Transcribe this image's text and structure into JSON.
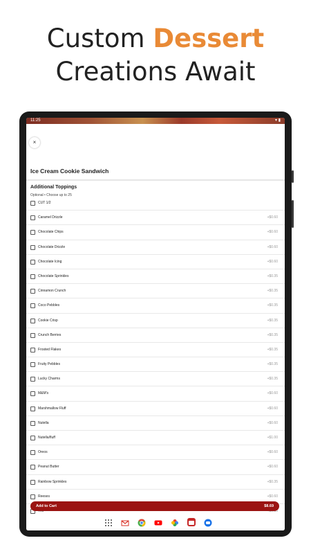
{
  "headline": {
    "line1_prefix": "Custom ",
    "line1_accent": "Dessert",
    "line2": "Creations Await"
  },
  "status": {
    "time": "11:25",
    "right": "▾ ▮"
  },
  "item": {
    "close": "×",
    "title": "Ice Cream Cookie Sandwich"
  },
  "section": {
    "title": "Additional Toppings",
    "subtitle": "Optional • Choose up to 25"
  },
  "options": [
    {
      "label": "CUT 1/2",
      "price": ""
    },
    {
      "label": "Caramel Drizzle",
      "price": "+$0.60"
    },
    {
      "label": "Chocolate Chips",
      "price": "+$0.60"
    },
    {
      "label": "Chocolate Drizzle",
      "price": "+$0.60"
    },
    {
      "label": "Chocolate Icing",
      "price": "+$0.60"
    },
    {
      "label": "Chocolate Sprinkles",
      "price": "+$0.35"
    },
    {
      "label": "Cinnamon Crunch",
      "price": "+$0.35"
    },
    {
      "label": "Coco Pebbles",
      "price": "+$0.35"
    },
    {
      "label": "Cookie Crisp",
      "price": "+$0.35"
    },
    {
      "label": "Crunch Berries",
      "price": "+$0.35"
    },
    {
      "label": "Frosted Flakes",
      "price": "+$0.35"
    },
    {
      "label": "Fruity Pebbles",
      "price": "+$0.35"
    },
    {
      "label": "Lucky Charms",
      "price": "+$0.35"
    },
    {
      "label": "M&M's",
      "price": "+$0.60"
    },
    {
      "label": "Marshmallow Fluff",
      "price": "+$0.60"
    },
    {
      "label": "Nutella",
      "price": "+$0.60"
    },
    {
      "label": "Nutella/fluff",
      "price": "+$1.00"
    },
    {
      "label": "Oreos",
      "price": "+$0.60"
    },
    {
      "label": "Peanut Butter",
      "price": "+$0.60"
    },
    {
      "label": "Rainbow Sprinkles",
      "price": "+$0.35"
    },
    {
      "label": "Reeses",
      "price": "+$0.60"
    },
    {
      "label": "Trix",
      "price": "+$0.35"
    }
  ],
  "cart": {
    "label": "Add to Cart",
    "price": "$8.69"
  },
  "dock": {
    "icons": [
      "apps-grid-icon",
      "gmail-icon",
      "chrome-icon",
      "youtube-icon",
      "photos-icon",
      "app-icon",
      "messages-icon"
    ]
  },
  "colors": {
    "accent": "#E98A36",
    "cart": "#9b1412"
  }
}
